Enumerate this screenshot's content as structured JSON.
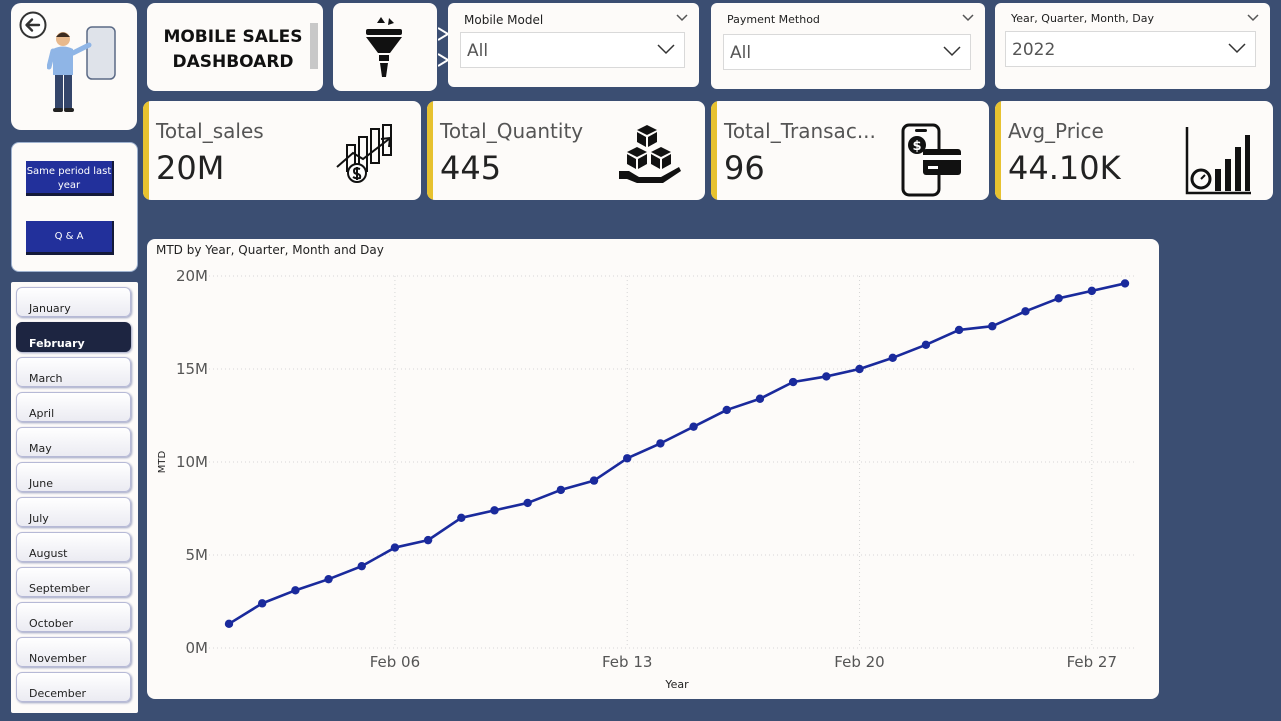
{
  "header": {
    "title_line1": "MOBILE SALES",
    "title_line2": "DASHBOARD"
  },
  "slicers": {
    "mobile_model": {
      "title": "Mobile Model",
      "value": "All"
    },
    "payment_method": {
      "title": "Payment Method",
      "value": "All"
    },
    "date": {
      "title": "Year, Quarter, Month, Day",
      "value": "2022"
    }
  },
  "kpis": [
    {
      "label": "Total_sales",
      "value": "20M",
      "icon": "sales-growth-icon"
    },
    {
      "label": "Total_Quantity",
      "value": "445",
      "icon": "boxes-hand-icon"
    },
    {
      "label": "Total_Transac...",
      "value": "96",
      "icon": "phone-card-icon"
    },
    {
      "label": "Avg_Price",
      "value": "44.10K",
      "icon": "bar-gauge-icon"
    }
  ],
  "side_buttons": {
    "same_period": "Same period last year",
    "qa": "Q & A"
  },
  "months": {
    "items": [
      "January",
      "February",
      "March",
      "April",
      "May",
      "June",
      "July",
      "August",
      "September",
      "October",
      "November",
      "December"
    ],
    "selected": "February"
  },
  "colors": {
    "background": "#3b4e72",
    "accent": "#e7c230",
    "line": "#1a2a9c",
    "button": "#22309b"
  },
  "chart_data": {
    "type": "line",
    "title": "MTD by Year, Quarter, Month and Day",
    "xlabel": "Year",
    "ylabel": "MTD",
    "ylim": [
      0,
      20000000
    ],
    "yticks": [
      "0M",
      "5M",
      "10M",
      "15M",
      "20M"
    ],
    "xticks": [
      "Feb 06",
      "Feb 13",
      "Feb 20",
      "Feb 27"
    ],
    "grid": true,
    "series": [
      {
        "x": [
          "Feb 01",
          "Feb 02",
          "Feb 03",
          "Feb 04",
          "Feb 05",
          "Feb 06",
          "Feb 07",
          "Feb 08",
          "Feb 09",
          "Feb 10",
          "Feb 11",
          "Feb 12",
          "Feb 13",
          "Feb 14",
          "Feb 15",
          "Feb 16",
          "Feb 17",
          "Feb 18",
          "Feb 19",
          "Feb 20",
          "Feb 21",
          "Feb 22",
          "Feb 23",
          "Feb 24",
          "Feb 25",
          "Feb 26",
          "Feb 27",
          "Feb 28"
        ],
        "values": [
          1300000,
          2400000,
          3100000,
          3700000,
          4400000,
          5400000,
          5800000,
          7000000,
          7400000,
          7800000,
          8500000,
          9000000,
          10200000,
          11000000,
          11900000,
          12800000,
          13400000,
          14300000,
          14600000,
          15000000,
          15600000,
          16300000,
          17100000,
          17300000,
          18100000,
          18800000,
          19200000,
          19600000
        ]
      }
    ]
  }
}
